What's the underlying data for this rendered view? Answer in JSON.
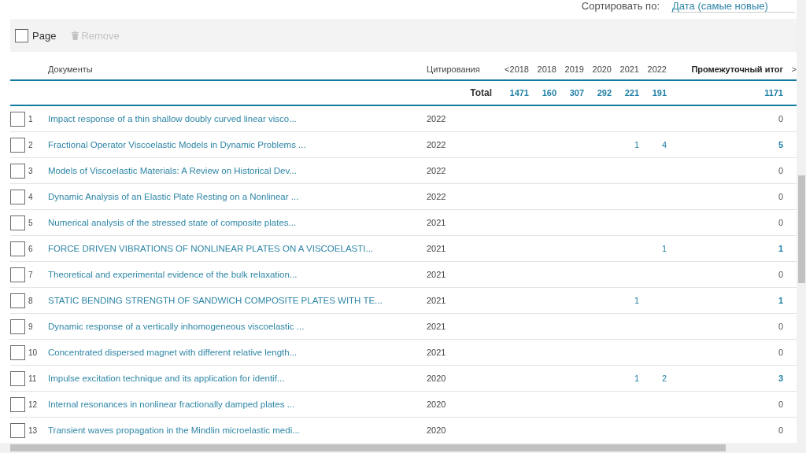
{
  "sort": {
    "label": "Сортировать по:",
    "value": "Дата (самые новые)"
  },
  "toolbar": {
    "page_select": {
      "label": "Page",
      "checked": false
    },
    "remove": {
      "label": "Remove",
      "disabled": true
    }
  },
  "table": {
    "columns": {
      "documents": "Документы",
      "citations": "Цитирования",
      "years": [
        "<2018",
        "2018",
        "2019",
        "2020",
        "2021",
        "2022"
      ],
      "subtotal": "Промежуточный итог",
      "more": ">"
    },
    "total": {
      "label": "Total",
      "values": [
        "1471",
        "160",
        "307",
        "292",
        "221",
        "191"
      ],
      "subtotal": "1171"
    },
    "rows": [
      {
        "number": "1",
        "title": "Impact response of a thin shallow doubly curved linear visco...",
        "year": "2022",
        "subtotal": "0",
        "cited": false,
        "checked": false
      },
      {
        "number": "2",
        "title": "Fractional Operator Viscoelastic Models in Dynamic Problems ...",
        "year": "2022",
        "citations": {
          "2021": "1",
          "2022": "4"
        },
        "subtotal": "5",
        "cited": true,
        "checked": false
      },
      {
        "number": "3",
        "title": "Models of Viscoelastic Materials: A Review on Historical Dev...",
        "year": "2022",
        "subtotal": "0",
        "cited": false,
        "checked": false
      },
      {
        "number": "4",
        "title": "Dynamic Analysis of an Elastic Plate Resting on a Nonlinear ...",
        "year": "2022",
        "subtotal": "0",
        "cited": false,
        "checked": false
      },
      {
        "number": "5",
        "title": "Numerical analysis of the stressed state of composite plates...",
        "year": "2021",
        "subtotal": "0",
        "cited": false,
        "checked": false
      },
      {
        "number": "6",
        "title": "FORCE DRIVEN VIBRATIONS OF NONLINEAR PLATES ON A VISCOELASTI...",
        "year": "2021",
        "citations": {
          "2022": "1"
        },
        "subtotal": "1",
        "cited": true,
        "checked": false
      },
      {
        "number": "7",
        "title": "Theoretical and experimental evidence of the bulk relaxation...",
        "year": "2021",
        "subtotal": "0",
        "cited": false,
        "checked": false
      },
      {
        "number": "8",
        "title": "STATIC BENDING STRENGTH OF SANDWICH COMPOSITE PLATES WITH TE...",
        "year": "2021",
        "citations": {
          "2021": "1"
        },
        "subtotal": "1",
        "cited": true,
        "checked": false
      },
      {
        "number": "9",
        "title": "Dynamic response of a vertically inhomogeneous viscoelastic ...",
        "year": "2021",
        "subtotal": "0",
        "cited": false,
        "checked": false
      },
      {
        "number": "10",
        "title": "Concentrated dispersed magnet with different relative length...",
        "year": "2021",
        "subtotal": "0",
        "cited": false,
        "checked": false
      },
      {
        "number": "11",
        "title": "Impulse excitation technique and its application for identif...",
        "year": "2020",
        "citations": {
          "2021": "1",
          "2022": "2"
        },
        "subtotal": "3",
        "cited": true,
        "checked": false
      },
      {
        "number": "12",
        "title": "Internal resonances in nonlinear fractionally damped plates ...",
        "year": "2020",
        "subtotal": "0",
        "cited": false,
        "checked": false
      },
      {
        "number": "13",
        "title": "Transient waves propagation in the Mindlin microelastic medi...",
        "year": "2020",
        "subtotal": "0",
        "cited": false,
        "checked": false
      }
    ]
  }
}
